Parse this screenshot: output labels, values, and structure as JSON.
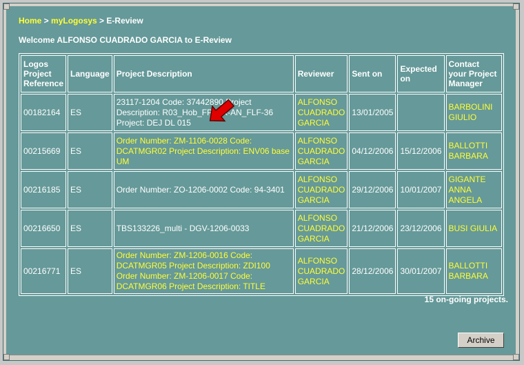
{
  "breadcrumb": {
    "home": "Home",
    "sep1": " > ",
    "mylogosys": "myLogosys",
    "sep2": " > ",
    "current": "E-Review"
  },
  "welcome": "Welcome ALFONSO CUADRADO GARCIA to E-Review",
  "table": {
    "headers": {
      "ref": "Logos Project Reference",
      "language": "Language",
      "description": "Project Description",
      "reviewer": "Reviewer",
      "sent": "Sent on",
      "expected": "Expected on",
      "contact": "Contact your Project Manager"
    },
    "rows": [
      {
        "ref": "00182164",
        "language": "ES",
        "description": "23117-1204 Code: 37442890 Project Description: R03_Hob_FP-I3K-AN_FLF-36 Project: DEJ DL 015",
        "reviewer": "ALFONSO CUADRADO GARCIA",
        "sent": "13/01/2005",
        "expected": "",
        "contact": "BARBOLINI GIULIO"
      },
      {
        "ref": "00215669",
        "language": "ES",
        "description": "Order Number: ZM-1106-0028 Code: DCATMGR02 Project Description: ENV06 base UM",
        "reviewer": "ALFONSO CUADRADO GARCIA",
        "sent": "04/12/2006",
        "expected": "15/12/2006",
        "contact": "BALLOTTI BARBARA"
      },
      {
        "ref": "00216185",
        "language": "ES",
        "description": "Order Number: ZO-1206-0002 Code: 94-3401",
        "reviewer": "ALFONSO CUADRADO GARCIA",
        "sent": "29/12/2006",
        "expected": "10/01/2007",
        "contact": "GIGANTE ANNA ANGELA"
      },
      {
        "ref": "00216650",
        "language": "ES",
        "description": "TBS133226_multi - DGV-1206-0033",
        "reviewer": "ALFONSO CUADRADO GARCIA",
        "sent": "21/12/2006",
        "expected": "23/12/2006",
        "contact": "BUSI GIULIA"
      },
      {
        "ref": "00216771",
        "language": "ES",
        "description": "Order Number: ZM-1206-0016 Code: DCATMGR05 Project Description: ZDI100 Order Number: ZM-1206-0017 Code: DCATMGR06 Project Description: TITLE",
        "reviewer": "ALFONSO CUADRADO GARCIA",
        "sent": "28/12/2006",
        "expected": "30/01/2007",
        "contact": "BALLOTTI BARBARA"
      }
    ]
  },
  "ongoing": "15 on-going projects.",
  "archive_label": "Archive",
  "colors": {
    "background": "#669999",
    "link": "#ffff33",
    "text": "#ffffff",
    "arrow": "#e00000"
  },
  "icons": {
    "pointer": "red-arrow-icon"
  }
}
